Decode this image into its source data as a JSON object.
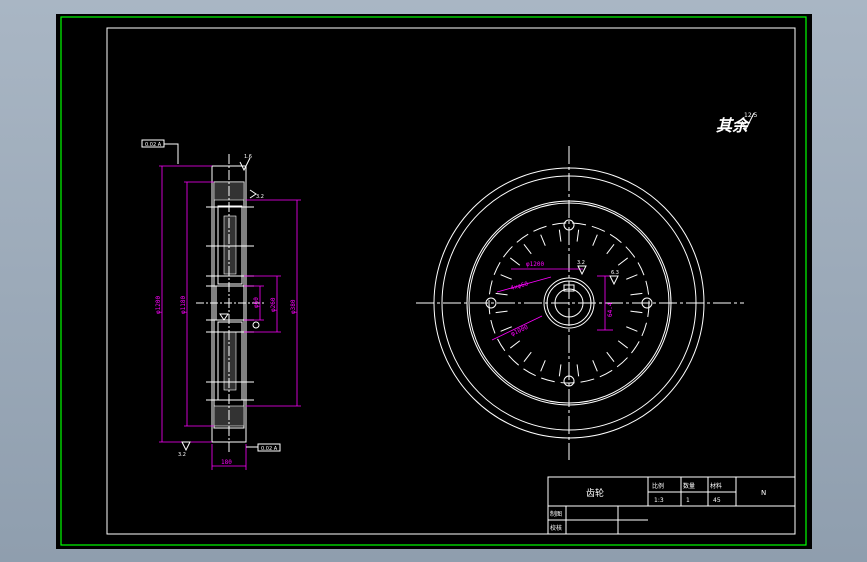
{
  "drawing": {
    "title_mark": "其余",
    "title_mark_roughness": "12.5",
    "part_name": "齿轮",
    "scale_label": "比例",
    "scale_value": "1:3",
    "quantity_label": "数量",
    "quantity_value": "1",
    "material_label": "材料",
    "material_value": "45",
    "sheet_code": "N",
    "drawn_by_label": "制图",
    "checked_by_label": "校核"
  },
  "side_view": {
    "dim_total_diameter": "φ1200",
    "dim_pitch_diameter": "φ1180",
    "dim_hub_outer": "φ380",
    "dim_hub_inner": "φ260",
    "dim_bore": "φ60",
    "dim_width": "180",
    "roughness_top": "1.6",
    "roughness_side": "3.2",
    "roughness_bottom": "3.2",
    "datum_top": "0.02 A",
    "datum_bottom": "0.02 A"
  },
  "front_view": {
    "dim_hole_circle": "φ1000",
    "dim_hole_pattern": "4xφ60",
    "dim_web_circle": "φ1200",
    "dim_keyway": "64.4",
    "roughness_hub": "3.2",
    "roughness_keyway": "6.3"
  },
  "colors": {
    "border": "#00ff00",
    "lines": "#ffffff",
    "dimensions": "#ff00ff",
    "background": "#000000"
  }
}
